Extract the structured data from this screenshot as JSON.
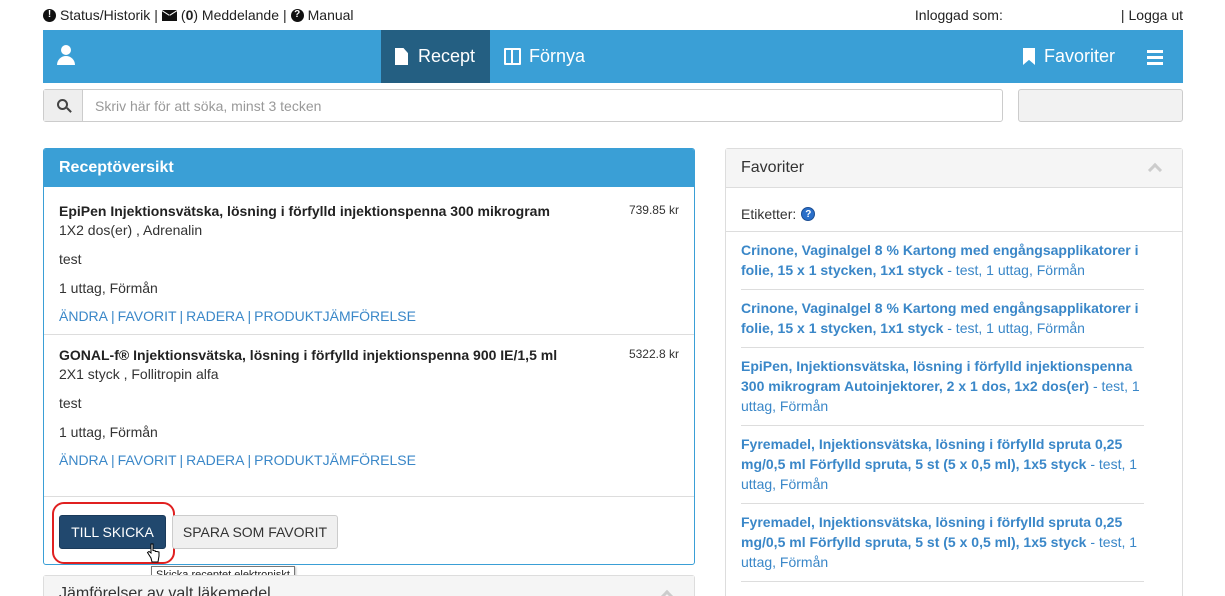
{
  "topbar": {
    "status_label": "Status/Historik",
    "messages_count": "0",
    "messages_label": "Meddelande",
    "manual_label": "Manual",
    "logged_in_label": "Inloggad som:",
    "logout_label": "Logga ut"
  },
  "nav": {
    "recept_label": "Recept",
    "fornya_label": "Förnya",
    "favoriter_label": "Favoriter"
  },
  "search": {
    "placeholder": "Skriv här för att söka, minst 3 tecken"
  },
  "recept_panel": {
    "title": "Receptöversikt",
    "items": [
      {
        "name": "EpiPen Injektionsvätska, lösning i förfylld injektionspenna 300 mikrogram",
        "price": "739.85 kr",
        "dosage": "1X2 dos(er) , Adrenalin",
        "note": "test",
        "withdrawal": "1 uttag, Förmån",
        "links": [
          "ÄNDRA",
          "FAVORIT",
          "RADERA",
          "PRODUKTJÄMFÖRELSE"
        ]
      },
      {
        "name": "GONAL-f® Injektionsvätska, lösning i förfylld injektionspenna 900 IE/1,5 ml",
        "price": "5322.8 kr",
        "dosage": "2X1 styck , Follitropin alfa",
        "note": "test",
        "withdrawal": "1 uttag, Förmån",
        "links": [
          "ÄNDRA",
          "FAVORIT",
          "RADERA",
          "PRODUKTJÄMFÖRELSE"
        ]
      }
    ],
    "send_button": "TILL SKICKA",
    "save_favorite_button": "SPARA SOM FAVORIT",
    "send_tooltip": "Skicka receptet elektroniskt"
  },
  "compare_panel": {
    "title": "Jämförelser av valt läkemedel"
  },
  "favorites_panel": {
    "title": "Favoriter",
    "tags_label": "Etiketter:",
    "items": [
      {
        "bold": "Crinone, Vaginalgel 8 % Kartong med engångsapplikatorer i folie, 15 x 1 stycken, 1x1 styck",
        "rest": " - test, 1 uttag, Förmån"
      },
      {
        "bold": "Crinone, Vaginalgel 8 % Kartong med engångsapplikatorer i folie, 15 x 1 stycken, 1x1 styck",
        "rest": " - test, 1 uttag, Förmån"
      },
      {
        "bold": "EpiPen, Injektionsvätska, lösning i förfylld injektionspenna 300 mikrogram Autoinjektorer, 2 x 1 dos, 1x2 dos(er)",
        "rest": " - test, 1 uttag, Förmån"
      },
      {
        "bold": "Fyremadel, Injektionsvätska, lösning i förfylld spruta 0,25 mg/0,5 ml Förfylld spruta, 5 st (5 x 0,5 ml), 1x5 styck",
        "rest": " - test, 1 uttag, Förmån"
      },
      {
        "bold": "Fyremadel, Injektionsvätska, lösning i förfylld spruta 0,25 mg/0,5 ml Förfylld spruta, 5 st (5 x 0,5 ml), 1x5 styck",
        "rest": " - test, 1 uttag, Förmån"
      }
    ]
  },
  "colors": {
    "nav_bg": "#3a9fd6",
    "nav_active": "#245f82",
    "link": "#3a87c8",
    "primary_button": "#21486e",
    "highlight": "#e02020"
  },
  "icons": [
    "exclamation-circle-icon",
    "envelope-icon",
    "question-circle-icon",
    "user-icon",
    "document-icon",
    "book-icon",
    "bookmark-icon",
    "hamburger-icon",
    "search-icon",
    "help-icon",
    "chevron-up-icon",
    "cursor-hand-icon"
  ]
}
